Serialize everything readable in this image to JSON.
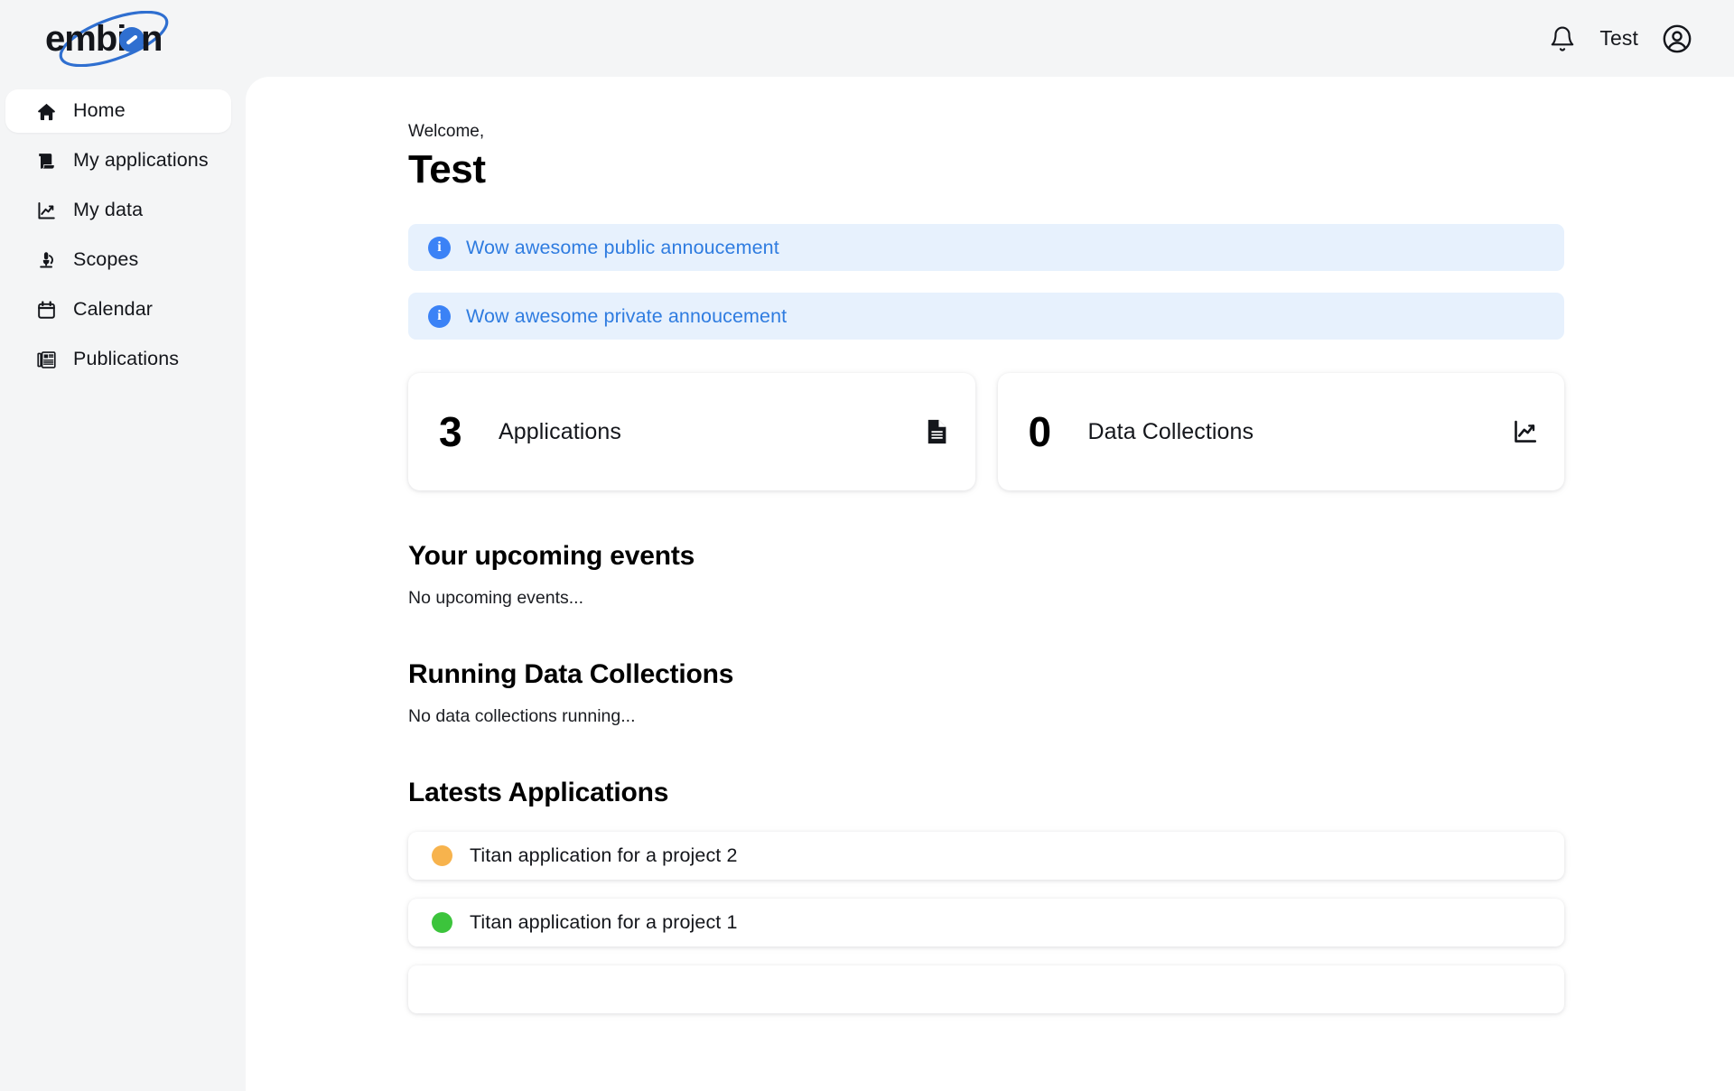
{
  "header": {
    "logo_text": "embion",
    "logo_icon": "embion-orbit-logo",
    "notifications_icon": "bell-icon",
    "username": "Test",
    "avatar_icon": "user-circle-icon"
  },
  "sidebar": {
    "items": [
      {
        "label": "Home",
        "icon": "home-icon",
        "active": true
      },
      {
        "label": "My applications",
        "icon": "scroll-icon",
        "active": false
      },
      {
        "label": "My data",
        "icon": "line-chart-icon",
        "active": false
      },
      {
        "label": "Scopes",
        "icon": "microscope-icon",
        "active": false
      },
      {
        "label": "Calendar",
        "icon": "calendar-icon",
        "active": false
      },
      {
        "label": "Publications",
        "icon": "newspaper-icon",
        "active": false
      }
    ]
  },
  "main": {
    "welcome_prefix": "Welcome,",
    "welcome_name": "Test",
    "announcements": [
      {
        "text": "Wow awesome public annoucement",
        "icon": "info-icon",
        "glyph": "i"
      },
      {
        "text": "Wow awesome private annoucement",
        "icon": "info-icon",
        "glyph": "i"
      }
    ],
    "stats": [
      {
        "value": "3",
        "label": "Applications",
        "icon": "document-icon"
      },
      {
        "value": "0",
        "label": "Data Collections",
        "icon": "line-chart-icon"
      }
    ],
    "sections": {
      "events": {
        "title": "Your upcoming events",
        "empty": "No upcoming events..."
      },
      "collections": {
        "title": "Running Data Collections",
        "empty": "No data collections running..."
      },
      "applications": {
        "title": "Latests Applications"
      }
    },
    "applications": [
      {
        "name": "Titan application for a project 2",
        "status_color": "#f7b34d"
      },
      {
        "name": "Titan application for a project 1",
        "status_color": "#3cc43c"
      },
      {
        "name": "",
        "status_color": "#ffffff"
      }
    ]
  },
  "colors": {
    "accent_blue": "#3b82f6",
    "announce_bg": "#e7f1fd",
    "announce_text": "#2f7ce0",
    "page_bg": "#f4f5f6",
    "panel_bg": "#ffffff",
    "status_pending": "#f7b34d",
    "status_approved": "#3cc43c"
  }
}
